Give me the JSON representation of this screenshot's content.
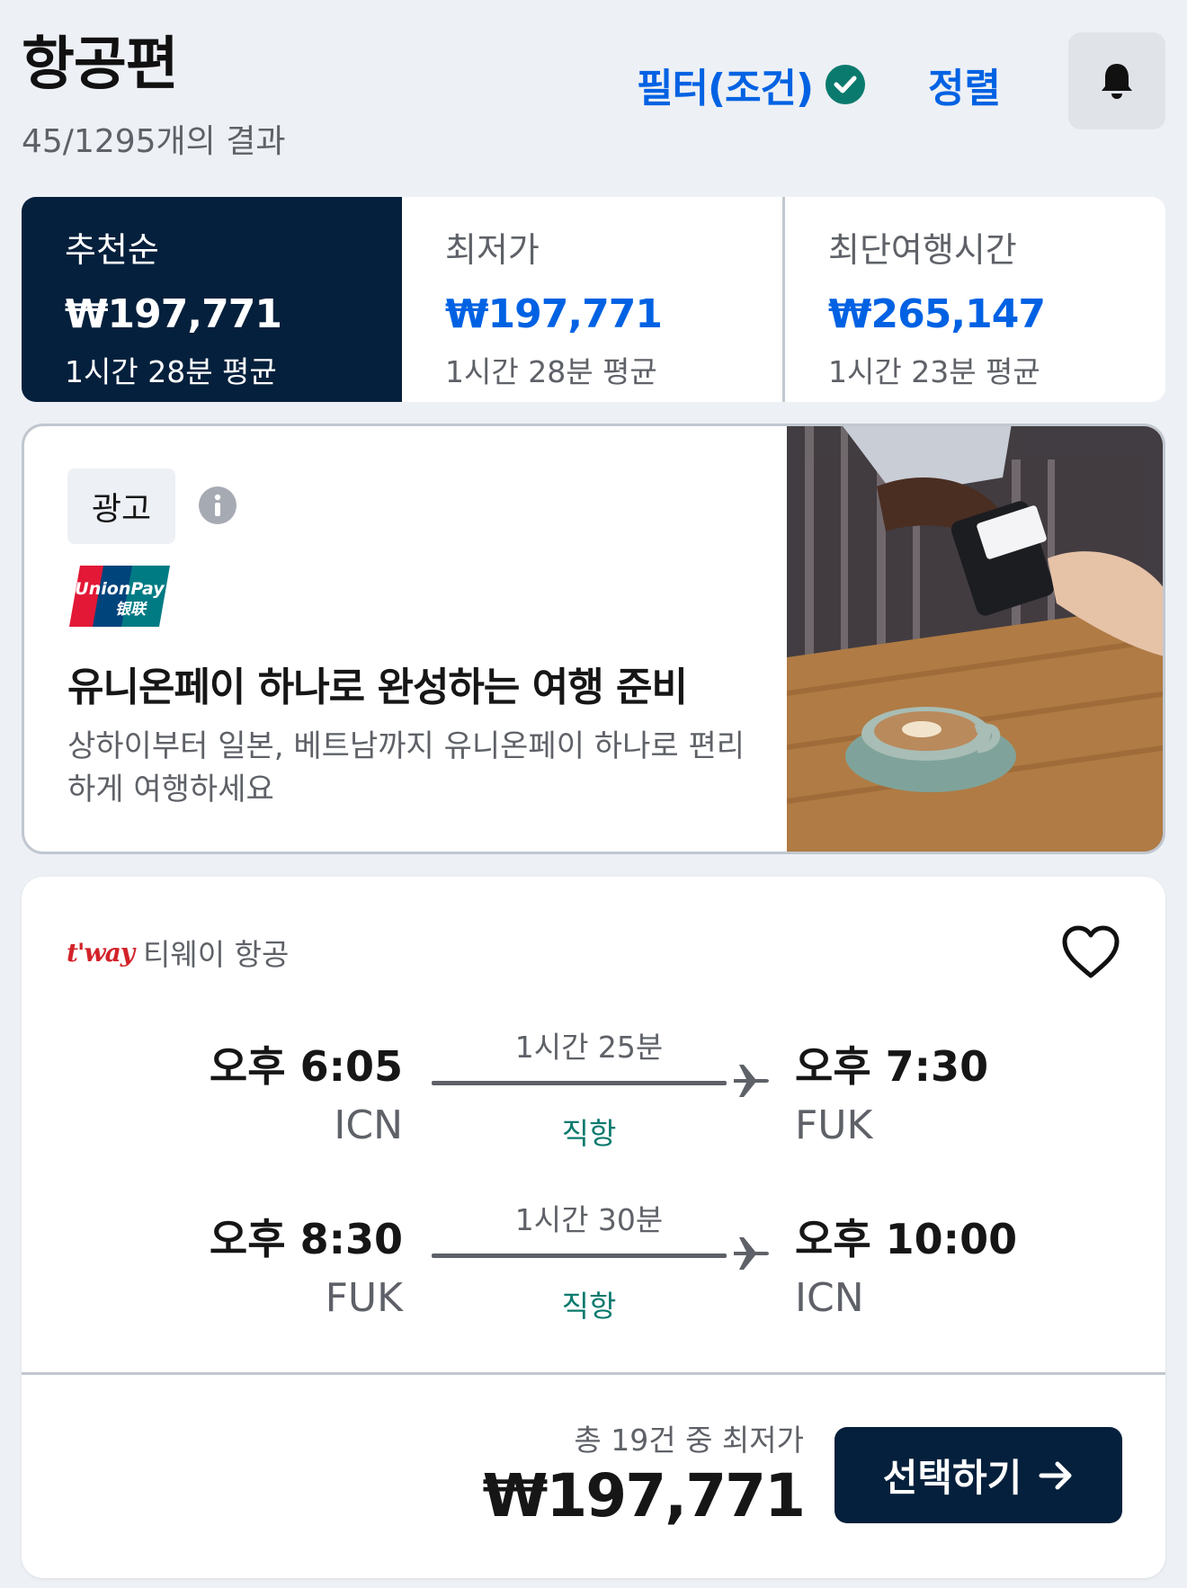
{
  "header": {
    "title": "항공편",
    "result_count": "45/1295개의 결과",
    "filter_label": "필터(조건)",
    "sort_label": "정렬"
  },
  "sort_tabs": [
    {
      "name": "추천순",
      "price": "₩197,771",
      "sub": "1시간 28분 평균",
      "active": true
    },
    {
      "name": "최저가",
      "price": "₩197,771",
      "sub": "1시간 28분 평균",
      "active": false
    },
    {
      "name": "최단여행시간",
      "price": "₩265,147",
      "sub": "1시간 23분 평균",
      "active": false
    }
  ],
  "ad": {
    "badge": "광고",
    "brand_logo_text": "UnionPay 银联",
    "title": "유니온페이 하나로 완성하는 여행 준비",
    "description": "상하이부터 일본, 베트남까지 유니온페이 하나로 편리하게 여행하세요"
  },
  "flight": {
    "airline_logo": "t'way",
    "airline_name": "티웨이 항공",
    "legs": [
      {
        "dep_time": "오후 6:05",
        "dep_code": "ICN",
        "duration": "1시간 25분",
        "stops": "직항",
        "arr_time": "오후 7:30",
        "arr_code": "FUK"
      },
      {
        "dep_time": "오후 8:30",
        "dep_code": "FUK",
        "duration": "1시간 30분",
        "stops": "직항",
        "arr_time": "오후 10:00",
        "arr_code": "ICN"
      }
    ],
    "price_caption": "총 19건 중 최저가",
    "price": "₩197,771",
    "select_label": "선택하기"
  },
  "colors": {
    "accent_blue": "#0062e3",
    "navy": "#05203c",
    "green": "#0b7a6e",
    "background": "#edf0f5"
  },
  "icons": [
    "check-circle-icon",
    "bell-icon",
    "info-icon",
    "heart-icon",
    "airplane-icon",
    "arrow-right-icon"
  ]
}
